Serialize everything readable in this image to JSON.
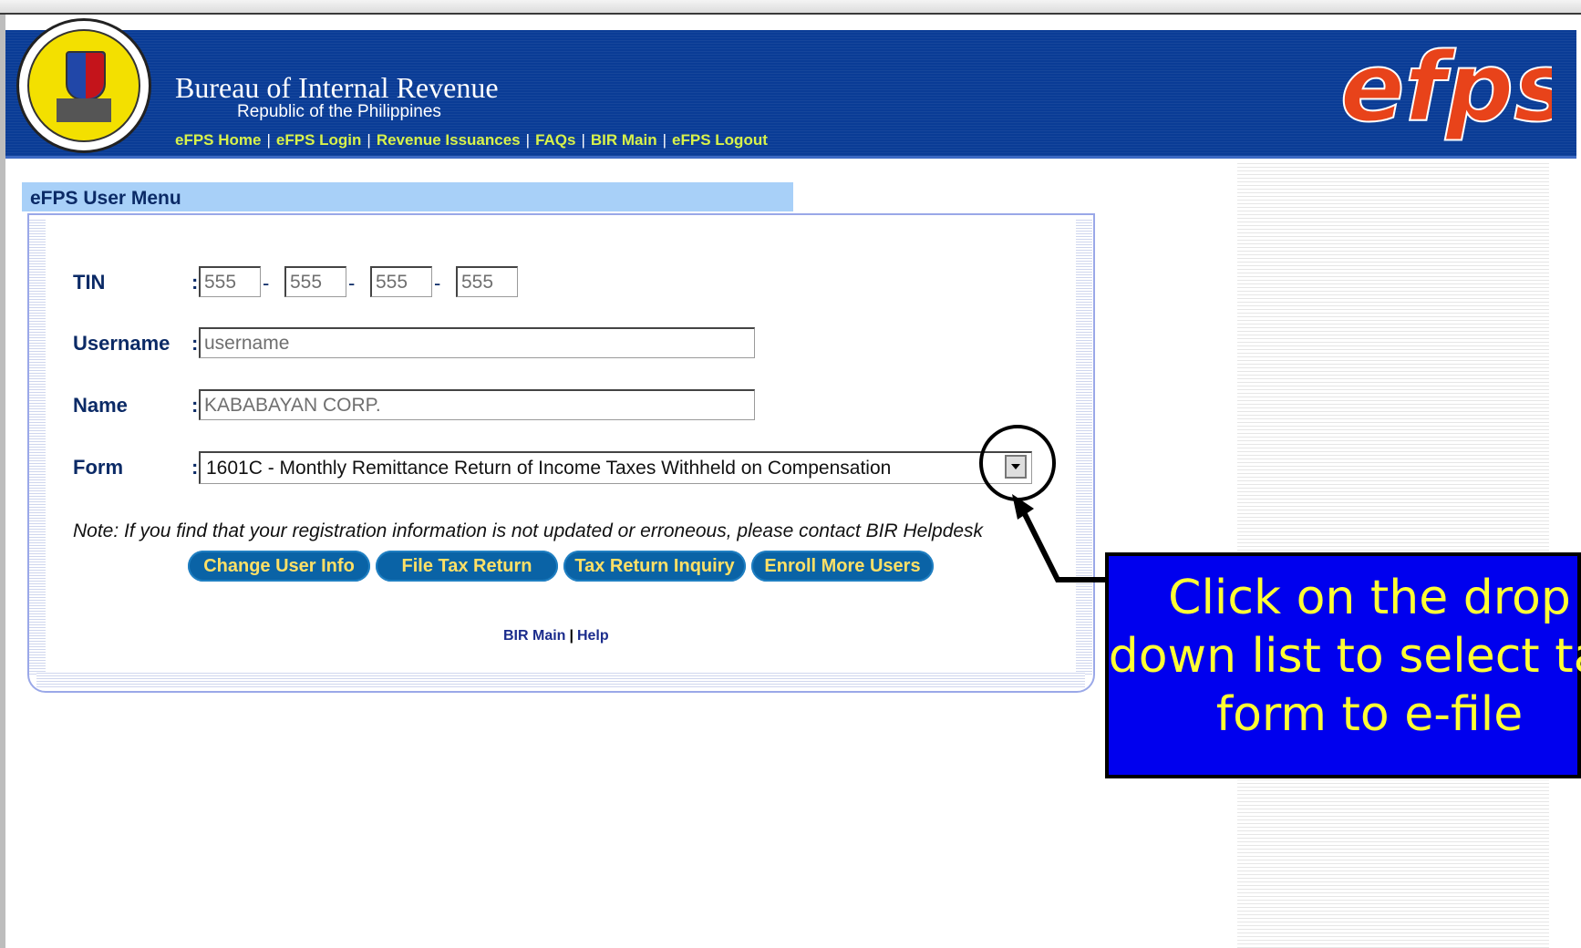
{
  "header": {
    "title": "Bureau of Internal Revenue",
    "subtitle": "Republic of the Philippines",
    "logo_text": "efps",
    "nav": [
      {
        "label": "eFPS Home"
      },
      {
        "label": "eFPS Login"
      },
      {
        "label": "Revenue Issuances"
      },
      {
        "label": "FAQs"
      },
      {
        "label": "BIR Main"
      },
      {
        "label": "eFPS Logout"
      }
    ],
    "nav_separator": "|"
  },
  "menu": {
    "title": "eFPS User Menu"
  },
  "form": {
    "tin_label": "TIN",
    "username_label": "Username",
    "name_label": "Name",
    "form_label": "Form",
    "colon": ":",
    "tin_parts": [
      "555",
      "555",
      "555",
      "555"
    ],
    "tin_dash": "-",
    "username_value": "username",
    "name_value": "KABABAYAN CORP.",
    "form_selected": "1601C - Monthly Remittance Return of Income Taxes Withheld on Compensation",
    "note": "Note: If you find that your registration information is not updated or erroneous, please contact BIR Helpdesk"
  },
  "buttons": {
    "change_user_info": "Change User Info",
    "file_tax_return": "File Tax Return",
    "tax_return_inquiry": "Tax Return Inquiry",
    "enroll_more_users": "Enroll More Users"
  },
  "footer_links": {
    "bir_main": "BIR Main",
    "separator": "|",
    "help": "Help"
  },
  "callout": {
    "text": "Click on the drop down list to select tax form to e-file"
  },
  "colors": {
    "header_bg": "#0a3c96",
    "nav_link": "#d8f24a",
    "logo": "#e8431a",
    "button_bg": "#0a63a6",
    "button_text": "#ffe066",
    "callout_bg": "#0000ee",
    "callout_text": "#ffff33"
  },
  "icons": {
    "dropdown": "chevron-down-icon",
    "seal": "bir-seal-logo",
    "arrow": "pointer-arrow"
  }
}
